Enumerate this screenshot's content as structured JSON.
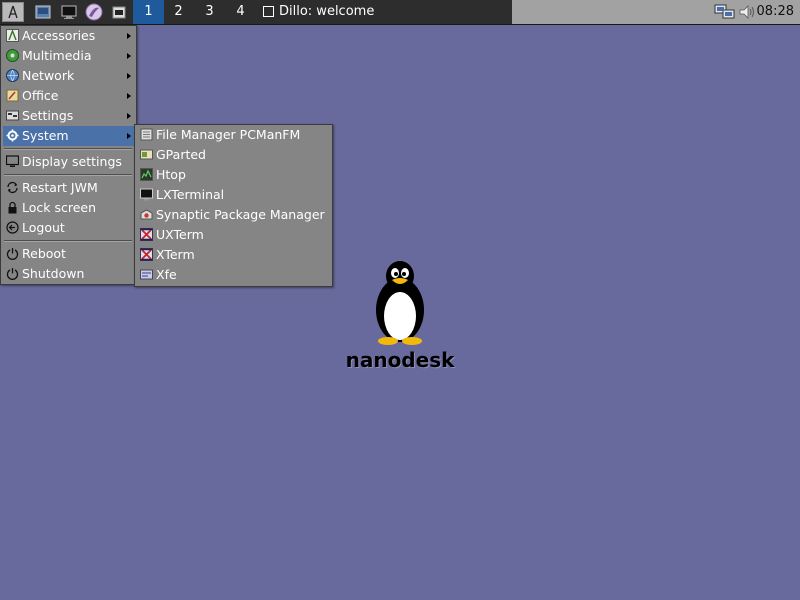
{
  "taskbar": {
    "launchers": [
      {
        "name": "app-menu"
      },
      {
        "name": "desktop"
      },
      {
        "name": "terminal"
      },
      {
        "name": "browser"
      },
      {
        "name": "file-manager"
      }
    ],
    "desktops": [
      "1",
      "2",
      "3",
      "4"
    ],
    "active_desktop": "1",
    "window_task": {
      "label": "Dillo: welcome"
    },
    "clock": "08:28"
  },
  "main_menu": {
    "categories": [
      {
        "label": "Accessories",
        "icon": "accessories-icon"
      },
      {
        "label": "Multimedia",
        "icon": "multimedia-icon"
      },
      {
        "label": "Network",
        "icon": "network-icon"
      },
      {
        "label": "Office",
        "icon": "office-icon"
      },
      {
        "label": "Settings",
        "icon": "settings-icon"
      },
      {
        "label": "System",
        "icon": "gear-icon"
      }
    ],
    "display_settings": "Display settings",
    "restart": "Restart JWM",
    "lock": "Lock screen",
    "logout": "Logout",
    "reboot": "Reboot",
    "shutdown": "Shutdown"
  },
  "system_submenu": {
    "items": [
      {
        "label": "File Manager PCManFM"
      },
      {
        "label": "GParted"
      },
      {
        "label": "Htop"
      },
      {
        "label": "LXTerminal"
      },
      {
        "label": "Synaptic Package Manager"
      },
      {
        "label": "UXTerm"
      },
      {
        "label": "XTerm"
      },
      {
        "label": "Xfe"
      }
    ]
  },
  "desktop": {
    "logo_text": "nanodesk"
  },
  "colors": {
    "desktop_bg": "#68699d",
    "taskbar_bg": "#2d2d2d",
    "menu_bg": "#858585",
    "selected_bg": "#4b72a8",
    "active_desktop_bg": "#1e5a9c"
  }
}
